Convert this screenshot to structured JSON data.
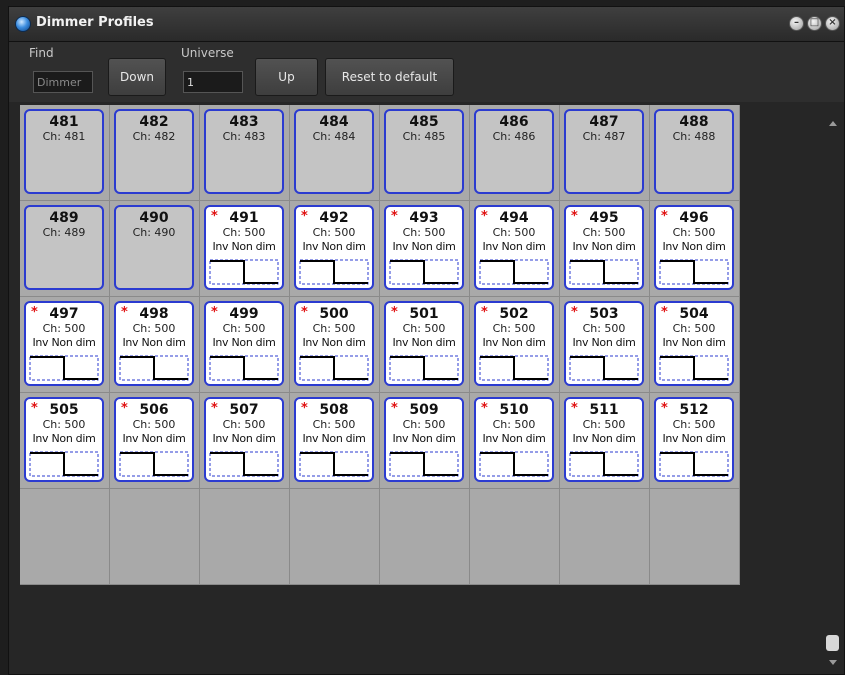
{
  "window": {
    "title": "Dimmer Profiles",
    "controls": [
      "minimize-icon",
      "maximize-icon",
      "close-icon"
    ]
  },
  "toolbar": {
    "find_label": "Find",
    "find_placeholder": "Dimmer",
    "universe_label": "Universe",
    "universe_value": "1",
    "down_label": "Down",
    "up_label": "Up",
    "reset_label": "Reset to default"
  },
  "grid": {
    "columns": 8,
    "empty_slots": 8,
    "channels": [
      {
        "num": "481",
        "ch": "Ch: 481",
        "mode": "",
        "custom": false
      },
      {
        "num": "482",
        "ch": "Ch: 482",
        "mode": "",
        "custom": false
      },
      {
        "num": "483",
        "ch": "Ch: 483",
        "mode": "",
        "custom": false
      },
      {
        "num": "484",
        "ch": "Ch: 484",
        "mode": "",
        "custom": false
      },
      {
        "num": "485",
        "ch": "Ch: 485",
        "mode": "",
        "custom": false
      },
      {
        "num": "486",
        "ch": "Ch: 486",
        "mode": "",
        "custom": false
      },
      {
        "num": "487",
        "ch": "Ch: 487",
        "mode": "",
        "custom": false
      },
      {
        "num": "488",
        "ch": "Ch: 488",
        "mode": "",
        "custom": false
      },
      {
        "num": "489",
        "ch": "Ch: 489",
        "mode": "",
        "custom": false
      },
      {
        "num": "490",
        "ch": "Ch: 490",
        "mode": "",
        "custom": false
      },
      {
        "num": "491",
        "ch": "Ch: 500",
        "mode": "Inv Non dim",
        "custom": true
      },
      {
        "num": "492",
        "ch": "Ch: 500",
        "mode": "Inv Non dim",
        "custom": true
      },
      {
        "num": "493",
        "ch": "Ch: 500",
        "mode": "Inv Non dim",
        "custom": true
      },
      {
        "num": "494",
        "ch": "Ch: 500",
        "mode": "Inv Non dim",
        "custom": true
      },
      {
        "num": "495",
        "ch": "Ch: 500",
        "mode": "Inv Non dim",
        "custom": true
      },
      {
        "num": "496",
        "ch": "Ch: 500",
        "mode": "Inv Non dim",
        "custom": true
      },
      {
        "num": "497",
        "ch": "Ch: 500",
        "mode": "Inv Non dim",
        "custom": true
      },
      {
        "num": "498",
        "ch": "Ch: 500",
        "mode": "Inv Non dim",
        "custom": true
      },
      {
        "num": "499",
        "ch": "Ch: 500",
        "mode": "Inv Non dim",
        "custom": true
      },
      {
        "num": "500",
        "ch": "Ch: 500",
        "mode": "Inv Non dim",
        "custom": true
      },
      {
        "num": "501",
        "ch": "Ch: 500",
        "mode": "Inv Non dim",
        "custom": true
      },
      {
        "num": "502",
        "ch": "Ch: 500",
        "mode": "Inv Non dim",
        "custom": true
      },
      {
        "num": "503",
        "ch": "Ch: 500",
        "mode": "Inv Non dim",
        "custom": true
      },
      {
        "num": "504",
        "ch": "Ch: 500",
        "mode": "Inv Non dim",
        "custom": true
      },
      {
        "num": "505",
        "ch": "Ch: 500",
        "mode": "Inv Non dim",
        "custom": true
      },
      {
        "num": "506",
        "ch": "Ch: 500",
        "mode": "Inv Non dim",
        "custom": true
      },
      {
        "num": "507",
        "ch": "Ch: 500",
        "mode": "Inv Non dim",
        "custom": true
      },
      {
        "num": "508",
        "ch": "Ch: 500",
        "mode": "Inv Non dim",
        "custom": true
      },
      {
        "num": "509",
        "ch": "Ch: 500",
        "mode": "Inv Non dim",
        "custom": true
      },
      {
        "num": "510",
        "ch": "Ch: 500",
        "mode": "Inv Non dim",
        "custom": true
      },
      {
        "num": "511",
        "ch": "Ch: 500",
        "mode": "Inv Non dim",
        "custom": true
      },
      {
        "num": "512",
        "ch": "Ch: 500",
        "mode": "Inv Non dim",
        "custom": true
      }
    ],
    "modified_marker": "*"
  },
  "colors": {
    "card_border": "#2b3bd0",
    "modified_marker": "#e01010",
    "grid_background": "#a9a9a9"
  }
}
